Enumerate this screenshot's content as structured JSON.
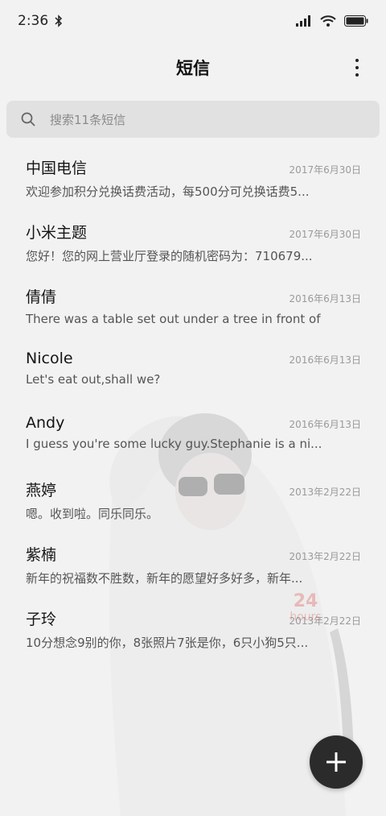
{
  "status_bar": {
    "time": "2:36",
    "bluetooth_icon": "bluetooth-icon",
    "signal_icon": "signal-icon",
    "wifi_icon": "wifi-icon",
    "battery_icon": "battery-icon"
  },
  "header": {
    "title": "短信",
    "more_icon": "more-vert-icon"
  },
  "search": {
    "placeholder": "搜索11条短信",
    "icon": "search-icon"
  },
  "conversations": [
    {
      "name": "中国电信",
      "date": "2017年6月30日",
      "preview": "欢迎参加积分兑换话费活动，每500分可兑换话费5..."
    },
    {
      "name": "小米主题",
      "date": "2017年6月30日",
      "preview": "您好！您的网上营业厅登录的随机密码为：710679..."
    },
    {
      "name": "倩倩",
      "date": "2016年6月13日",
      "preview": "There was a table set out under a tree in front of ..."
    },
    {
      "name": "Nicole",
      "date": "2016年6月13日",
      "preview": "Let's eat out,shall we?"
    },
    {
      "name": "Andy",
      "date": "2016年6月13日",
      "preview": "I guess you're some lucky guy.Stephanie is a ni..."
    },
    {
      "name": "燕婷",
      "date": "2013年2月22日",
      "preview": "嗯。收到啦。同乐同乐。"
    },
    {
      "name": "紫楠",
      "date": "2013年2月22日",
      "preview": "新年的祝福数不胜数，新年的愿望好多好多，新年..."
    },
    {
      "name": "子玲",
      "date": "2013年2月22日",
      "preview": "10分想念9别的你，8张照片7张是你，6只小狗5只..."
    }
  ],
  "watermark": {
    "number": "24",
    "text": "hours"
  },
  "fab": {
    "icon": "plus-icon"
  },
  "colors": {
    "background": "#f2f2f2",
    "search_bg": "#e1e1e1",
    "fab": "#2b2b2b"
  }
}
